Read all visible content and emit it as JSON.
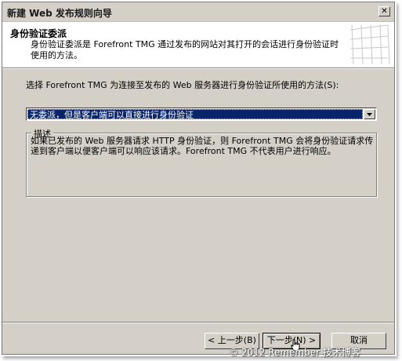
{
  "window": {
    "title": "新建 Web 发布规则向导",
    "close_glyph": "✕"
  },
  "header": {
    "title": "身份验证委派",
    "subtitle": "身份验证委派是 Forefront TMG 通过发布的网站对其打开的会话进行身份验证时使用的方法。"
  },
  "main": {
    "prompt": "选择 Forefront TMG 为连接至发布的 Web 服务器进行身份验证所使用的方法(S):",
    "method_select": {
      "selected": "无委派，但是客户端可以直接进行身份验证"
    },
    "description": {
      "legend": "描述",
      "text": "如果已发布的 Web 服务器请求 HTTP 身份验证，则 Forefront TMG 会将身份验证请求传递到客户端以便客户端可以响应该请求。Forefront TMG 不代表用户进行响应。"
    }
  },
  "footer": {
    "back_label": "< 上一步(B)",
    "next_label": "下一步(N) >",
    "cancel_label": "取消"
  },
  "watermark": "© 2012 Remember 技术博客",
  "colors": {
    "dialog_bg": "#d4d0c8",
    "selection_bg": "#0a246a"
  }
}
